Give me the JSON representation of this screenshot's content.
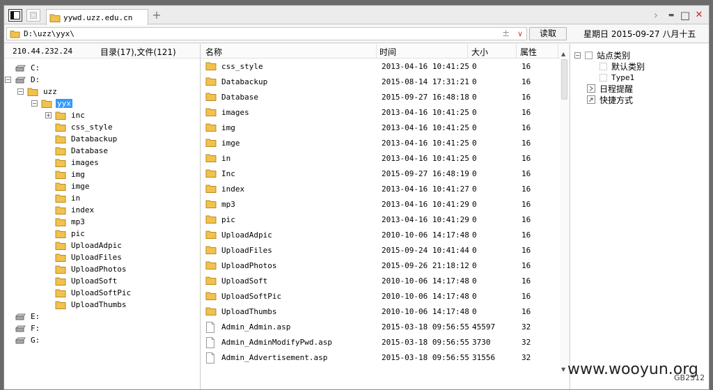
{
  "tabs": {
    "active_title": "yywd.uzz.edu.cn",
    "new_tab": "+"
  },
  "window_controls": {
    "forward": "›",
    "minimize": "▬",
    "maximize": "□",
    "close": "✕"
  },
  "address": {
    "path": "D:\\uzz\\yyx\\",
    "plus": "±",
    "dropdown": "∨",
    "read_button": "读取"
  },
  "date": "星期日 2015-09-27 八月十五",
  "left": {
    "server_ip": "210.44.232.24",
    "dir_count": "目录(17),文件(121)",
    "tree": [
      {
        "label": "C:",
        "type": "drive"
      },
      {
        "label": "D:",
        "type": "drive"
      },
      {
        "label": "uzz",
        "type": "folder"
      },
      {
        "label": "yyx",
        "type": "folder"
      },
      {
        "label": "inc",
        "type": "folder"
      },
      {
        "label": "css_style",
        "type": "folder"
      },
      {
        "label": "Databackup",
        "type": "folder"
      },
      {
        "label": "Database",
        "type": "folder"
      },
      {
        "label": "images",
        "type": "folder"
      },
      {
        "label": "img",
        "type": "folder"
      },
      {
        "label": "imge",
        "type": "folder"
      },
      {
        "label": "in",
        "type": "folder"
      },
      {
        "label": "index",
        "type": "folder"
      },
      {
        "label": "mp3",
        "type": "folder"
      },
      {
        "label": "pic",
        "type": "folder"
      },
      {
        "label": "UploadAdpic",
        "type": "folder"
      },
      {
        "label": "UploadFiles",
        "type": "folder"
      },
      {
        "label": "UploadPhotos",
        "type": "folder"
      },
      {
        "label": "UploadSoft",
        "type": "folder"
      },
      {
        "label": "UploadSoftPic",
        "type": "folder"
      },
      {
        "label": "UploadThumbs",
        "type": "folder"
      },
      {
        "label": "E:",
        "type": "drive"
      },
      {
        "label": "F:",
        "type": "drive"
      },
      {
        "label": "G:",
        "type": "drive"
      }
    ]
  },
  "columns": {
    "name": "名称",
    "time": "时间",
    "size": "大小",
    "attr": "属性"
  },
  "files": [
    {
      "name": "css_style",
      "time": "2013-04-16 10:41:25",
      "size": "0",
      "attr": "16",
      "type": "folder"
    },
    {
      "name": "Databackup",
      "time": "2015-08-14 17:31:21",
      "size": "0",
      "attr": "16",
      "type": "folder"
    },
    {
      "name": "Database",
      "time": "2015-09-27 16:48:18",
      "size": "0",
      "attr": "16",
      "type": "folder"
    },
    {
      "name": "images",
      "time": "2013-04-16 10:41:25",
      "size": "0",
      "attr": "16",
      "type": "folder"
    },
    {
      "name": "img",
      "time": "2013-04-16 10:41:25",
      "size": "0",
      "attr": "16",
      "type": "folder"
    },
    {
      "name": "imge",
      "time": "2013-04-16 10:41:25",
      "size": "0",
      "attr": "16",
      "type": "folder"
    },
    {
      "name": "in",
      "time": "2013-04-16 10:41:25",
      "size": "0",
      "attr": "16",
      "type": "folder"
    },
    {
      "name": "Inc",
      "time": "2015-09-27 16:48:19",
      "size": "0",
      "attr": "16",
      "type": "folder"
    },
    {
      "name": "index",
      "time": "2013-04-16 10:41:27",
      "size": "0",
      "attr": "16",
      "type": "folder"
    },
    {
      "name": "mp3",
      "time": "2013-04-16 10:41:29",
      "size": "0",
      "attr": "16",
      "type": "folder"
    },
    {
      "name": "pic",
      "time": "2013-04-16 10:41:29",
      "size": "0",
      "attr": "16",
      "type": "folder"
    },
    {
      "name": "UploadAdpic",
      "time": "2010-10-06 14:17:48",
      "size": "0",
      "attr": "16",
      "type": "folder"
    },
    {
      "name": "UploadFiles",
      "time": "2015-09-24 10:41:44",
      "size": "0",
      "attr": "16",
      "type": "folder"
    },
    {
      "name": "UploadPhotos",
      "time": "2015-09-26 21:18:12",
      "size": "0",
      "attr": "16",
      "type": "folder"
    },
    {
      "name": "UploadSoft",
      "time": "2010-10-06 14:17:48",
      "size": "0",
      "attr": "16",
      "type": "folder"
    },
    {
      "name": "UploadSoftPic",
      "time": "2010-10-06 14:17:48",
      "size": "0",
      "attr": "16",
      "type": "folder"
    },
    {
      "name": "UploadThumbs",
      "time": "2010-10-06 14:17:48",
      "size": "0",
      "attr": "16",
      "type": "folder"
    },
    {
      "name": "Admin_Admin.asp",
      "time": "2015-03-18 09:56:55",
      "size": "45597",
      "attr": "32",
      "type": "file"
    },
    {
      "name": "Admin_AdminModifyPwd.asp",
      "time": "2015-03-18 09:56:55",
      "size": "3730",
      "attr": "32",
      "type": "file"
    },
    {
      "name": "Admin_Advertisement.asp",
      "time": "2015-03-18 09:56:55",
      "size": "31556",
      "attr": "32",
      "type": "file"
    }
  ],
  "right": {
    "site_category": "站点类别",
    "default_category": "默认类别",
    "type1": "Type1",
    "reminder": "日程提醒",
    "shortcut": "快捷方式"
  },
  "watermark": "www.wooyun.org",
  "encoding": "GB2312",
  "colors": {
    "folder": "#f2c24f",
    "selection": "#3399ff",
    "close": "#cc2222"
  }
}
